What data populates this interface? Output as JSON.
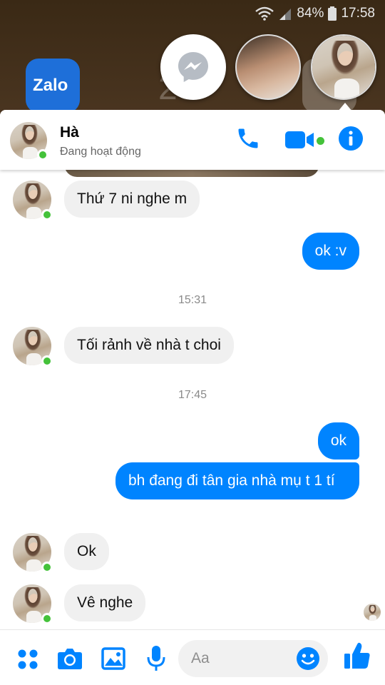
{
  "status_bar": {
    "battery": "84%",
    "time": "17:58"
  },
  "home_screen": {
    "zalo_label": "Zalo",
    "bg_number": "23"
  },
  "chat_header": {
    "name": "Hà",
    "status": "Đang hoạt động"
  },
  "messages": {
    "m1": "Thứ 7 ni nghe m",
    "m2": "ok :v",
    "t1": "15:31",
    "m3": "Tối rảnh về nhà t choi",
    "t2": "17:45",
    "m4": "ok",
    "m5": "bh đang đi tân gia nhà mụ t 1 tí",
    "m6": "Ok",
    "m7": "Vê nghe"
  },
  "composer": {
    "placeholder": "Aa"
  },
  "colors": {
    "accent": "#0084ff",
    "online": "#44c23a",
    "incoming_bubble": "#f0f0f0"
  }
}
